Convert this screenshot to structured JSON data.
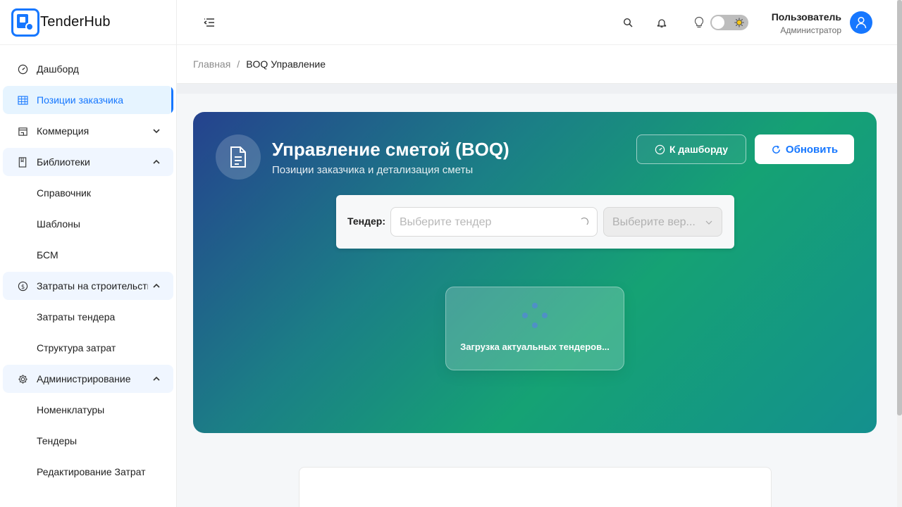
{
  "app": {
    "name": "TenderHub"
  },
  "sidebar": {
    "items": [
      {
        "label": "Дашборд",
        "icon": "dashboard-icon"
      },
      {
        "label": "Позиции заказчика",
        "icon": "table-icon"
      },
      {
        "label": "Коммерция",
        "icon": "shop-icon"
      },
      {
        "label": "Библиотеки",
        "icon": "book-icon"
      },
      {
        "label": "Затраты на строительство",
        "icon": "dollar-icon"
      },
      {
        "label": "Администрирование",
        "icon": "gear-icon"
      }
    ],
    "libraries_sub": [
      "Справочник",
      "Шаблоны",
      "БСМ"
    ],
    "costs_sub": [
      "Затраты тендера",
      "Структура затрат"
    ],
    "admin_sub": [
      "Номенклатуры",
      "Тендеры",
      "Редактирование Затрат"
    ]
  },
  "header": {
    "user_name": "Пользователь",
    "user_role": "Администратор",
    "theme_toggle": "light"
  },
  "breadcrumb": {
    "home": "Главная",
    "separator": "/",
    "current": "BOQ Управление"
  },
  "hero": {
    "title": "Управление сметой (BOQ)",
    "subtitle": "Позиции заказчика и детализация сметы",
    "dashboard_button": "К дашборду",
    "refresh_button": "Обновить"
  },
  "filter": {
    "tender_label": "Тендер:",
    "tender_placeholder": "Выберите тендер",
    "version_placeholder": "Выберите вер..."
  },
  "loader": {
    "text": "Загрузка актуальных тендеров..."
  },
  "colors": {
    "accent": "#1677ff",
    "hero_start": "#25428e",
    "hero_mid": "#15a274",
    "hero_end": "#14908e"
  }
}
